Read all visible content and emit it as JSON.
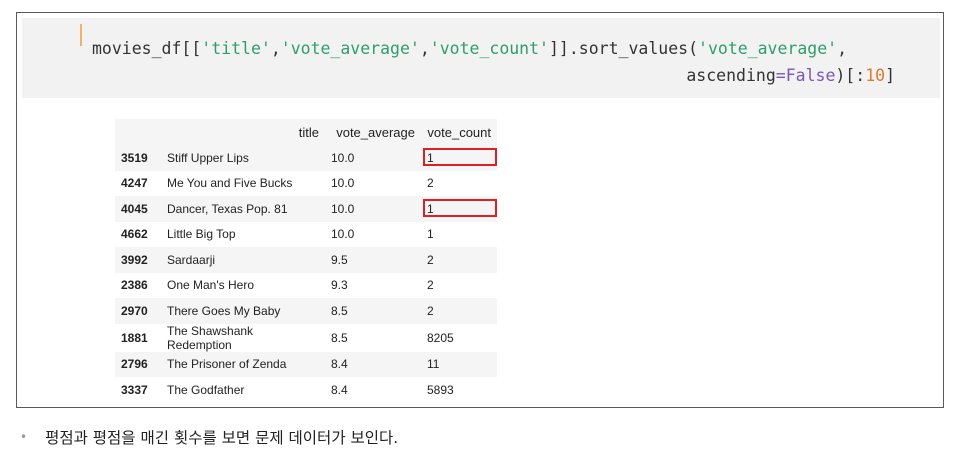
{
  "code": {
    "line1_prefix": "movies_df[[",
    "line1_str1": "'title'",
    "line1_comma1": ",",
    "line1_str2": "'vote_average'",
    "line1_comma2": ",",
    "line1_str3": "'vote_count'",
    "line1_mid": "]].sort_values(",
    "line1_str4": "'vote_average'",
    "line1_end": ",",
    "line2_kw": "ascending",
    "line2_op": "=",
    "line2_bool": "False",
    "line2_mid": ")[:",
    "line2_num": "10",
    "line2_end": "]"
  },
  "table": {
    "columns": [
      "",
      "title",
      "vote_average",
      "vote_count"
    ],
    "rows": [
      {
        "idx": "3519",
        "title": "Stiff Upper Lips",
        "avg": "10.0",
        "cnt": "1",
        "highlight": true
      },
      {
        "idx": "4247",
        "title": "Me You and Five Bucks",
        "avg": "10.0",
        "cnt": "2",
        "highlight": false
      },
      {
        "idx": "4045",
        "title": "Dancer, Texas Pop. 81",
        "avg": "10.0",
        "cnt": "1",
        "highlight": true
      },
      {
        "idx": "4662",
        "title": "Little Big Top",
        "avg": "10.0",
        "cnt": "1",
        "highlight": false
      },
      {
        "idx": "3992",
        "title": "Sardaarji",
        "avg": "9.5",
        "cnt": "2",
        "highlight": false
      },
      {
        "idx": "2386",
        "title": "One Man's Hero",
        "avg": "9.3",
        "cnt": "2",
        "highlight": false
      },
      {
        "idx": "2970",
        "title": "There Goes My Baby",
        "avg": "8.5",
        "cnt": "2",
        "highlight": false
      },
      {
        "idx": "1881",
        "title": "The Shawshank Redemption",
        "avg": "8.5",
        "cnt": "8205",
        "highlight": false
      },
      {
        "idx": "2796",
        "title": "The Prisoner of Zenda",
        "avg": "8.4",
        "cnt": "11",
        "highlight": false
      },
      {
        "idx": "3337",
        "title": "The Godfather",
        "avg": "8.4",
        "cnt": "5893",
        "highlight": false
      }
    ],
    "highlight_color": "#e02020"
  },
  "note": {
    "bullet": "•",
    "text": "평점과 평점을 매긴 횟수를 보면 문제 데이터가 보인다."
  }
}
